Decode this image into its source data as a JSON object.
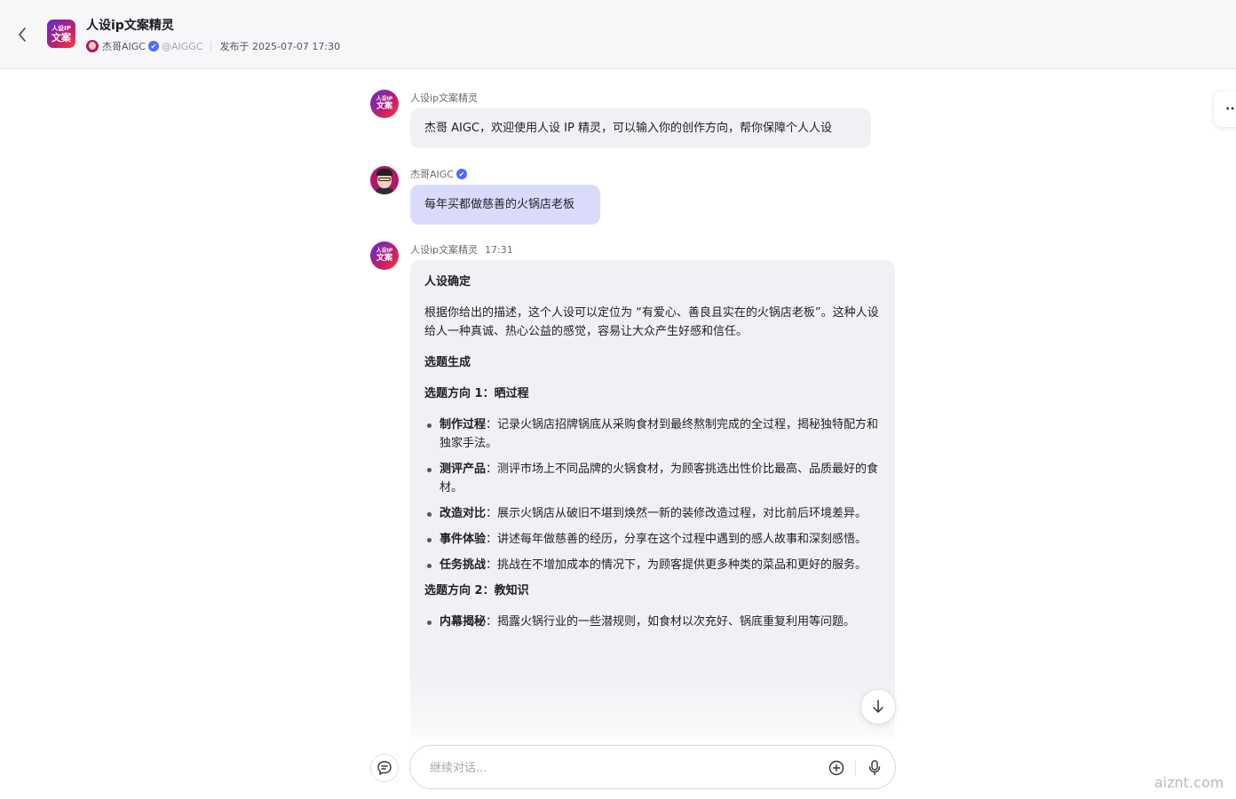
{
  "header": {
    "logo_line1": "人设IP",
    "logo_line2": "文案",
    "title": "人设ip文案精灵",
    "author": "杰哥AIGC",
    "verified_icon": "✔",
    "handle": "@AIGGC",
    "published": "发布于 2025-07-07 17:30"
  },
  "side": {
    "more_label": "··"
  },
  "messages": [
    {
      "role": "bot",
      "avatar_line1": "人设IP",
      "avatar_line2": "文案",
      "sender": "人设ip文案精灵",
      "text": "杰哥 AIGC，欢迎使用人设 IP 精灵，可以输入你的创作方向，帮你保障个人人设"
    },
    {
      "role": "user",
      "sender": "杰哥AIGC",
      "verified_icon": "✔",
      "text": "每年买都做慈善的火锅店老板"
    },
    {
      "role": "bot",
      "avatar_line1": "人设IP",
      "avatar_line2": "文案",
      "sender": "人设ip文案精灵",
      "time": "17:31",
      "content": {
        "h1": "人设确定",
        "p1": "根据你给出的描述，这个人设可以定位为 “有爱心、善良且实在的火锅店老板”。这种人设给人一种真诚、热心公益的感觉，容易让大众产生好感和信任。",
        "h2": "选题生成",
        "h3": "选题方向 1：晒过程",
        "list1": [
          {
            "term": "制作过程",
            "desc": "：记录火锅店招牌锅底从采购食材到最终熬制完成的全过程，揭秘独特配方和独家手法。"
          },
          {
            "term": "测评产品",
            "desc": "：测评市场上不同品牌的火锅食材，为顾客挑选出性价比最高、品质最好的食材。"
          },
          {
            "term": "改造对比",
            "desc": "：展示火锅店从破旧不堪到焕然一新的装修改造过程，对比前后环境差异。"
          },
          {
            "term": "事件体验",
            "desc": "：讲述每年做慈善的经历，分享在这个过程中遇到的感人故事和深刻感悟。"
          },
          {
            "term": "任务挑战",
            "desc": "：挑战在不增加成本的情况下，为顾客提供更多种类的菜品和更好的服务。"
          }
        ],
        "h4": "选题方向 2：教知识",
        "list2": [
          {
            "term": "内幕揭秘",
            "desc": "：揭露火锅行业的一些潜规则，如食材以次充好、锅底重复利用等问题。"
          }
        ]
      }
    }
  ],
  "input": {
    "placeholder": "继续对话..."
  },
  "watermark": "aiznt.com"
}
